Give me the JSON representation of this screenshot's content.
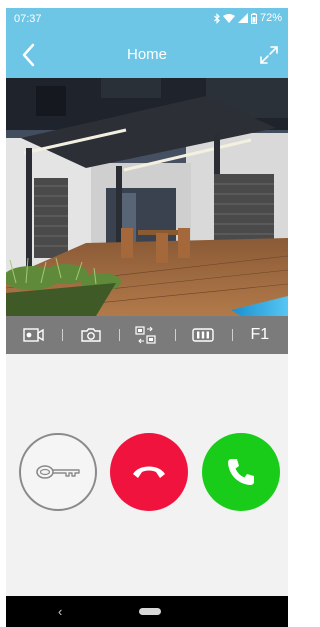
{
  "status_bar": {
    "time": "07:37",
    "battery_percent": "72%",
    "icons": [
      "bluetooth-icon",
      "wifi-icon",
      "signal-icon",
      "battery-icon"
    ]
  },
  "header": {
    "title": "Home",
    "back_icon": "chevron-left-icon",
    "expand_icon": "expand-icon"
  },
  "video": {
    "description_icon": "camera-feed"
  },
  "toolbar": {
    "items": [
      {
        "icon": "video-record-icon"
      },
      {
        "icon": "snapshot-camera-icon"
      },
      {
        "icon": "camera-switch-icon"
      },
      {
        "icon": "gallery-icon"
      },
      {
        "label": "F1"
      }
    ]
  },
  "actions": {
    "unlock_icon": "key-icon",
    "hangup_icon": "hangup-icon",
    "answer_icon": "phone-answer-icon",
    "colors": {
      "hangup": "#f0133d",
      "answer": "#19cc19",
      "key_border": "#8a8a8a"
    }
  },
  "nav_bar": {
    "back_glyph": "‹"
  },
  "colors": {
    "accent": "#6ec6e6",
    "toolbar": "#7b7b7b"
  }
}
